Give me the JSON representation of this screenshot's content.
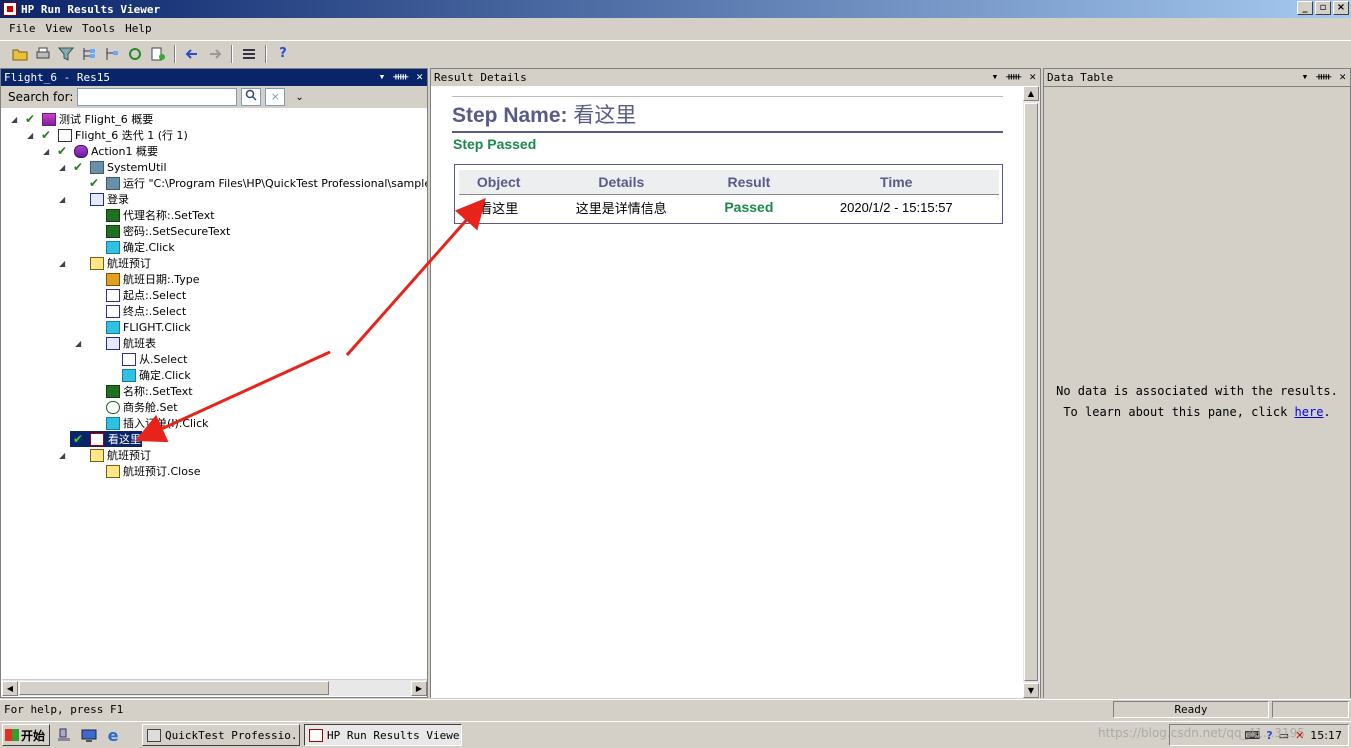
{
  "window": {
    "title": "HP Run Results Viewer"
  },
  "menu": [
    "File",
    "View",
    "Tools",
    "Help"
  ],
  "left_panel": {
    "title": "Flight_6 - Res15",
    "search_label": "Search for:",
    "search_value": "",
    "tree": [
      {
        "label": "测试 Flight_6 概要"
      },
      {
        "label": "Flight_6 迭代 1 (行 1)"
      },
      {
        "label": "Action1 概要"
      },
      {
        "label": "SystemUtil"
      },
      {
        "label": "运行 \"C:\\Program Files\\HP\\QuickTest Professional\\samples\\flig"
      },
      {
        "label": "登录"
      },
      {
        "label": "代理名称:.SetText"
      },
      {
        "label": "密码:.SetSecureText"
      },
      {
        "label": "确定.Click"
      },
      {
        "label": "航班预订"
      },
      {
        "label": "航班日期:.Type"
      },
      {
        "label": "起点:.Select"
      },
      {
        "label": "终点:.Select"
      },
      {
        "label": "FLIGHT.Click"
      },
      {
        "label": "航班表"
      },
      {
        "label": "从.Select"
      },
      {
        "label": "确定.Click"
      },
      {
        "label": "名称:.SetText"
      },
      {
        "label": "商务舱.Set"
      },
      {
        "label": "插入订单(I).Click"
      },
      {
        "label": "看这里"
      },
      {
        "label": "航班预订"
      },
      {
        "label": "航班预订.Close"
      }
    ]
  },
  "result_details": {
    "title": "Result Details",
    "step_name_label": "Step Name:",
    "step_name": "看这里",
    "status": "Step Passed",
    "columns": [
      "Object",
      "Details",
      "Result",
      "Time"
    ],
    "row": {
      "object": "看这里",
      "details": "这里是详情信息",
      "result": "Passed",
      "time": "2020/1/2 - 15:15:57"
    }
  },
  "data_table": {
    "title": "Data Table",
    "line1": "No data is associated with the results.",
    "line2_prefix": "To learn about this pane, click ",
    "link": "here",
    "line2_suffix": "."
  },
  "statusbar": {
    "help": "For help, press F1",
    "ready": "Ready"
  },
  "taskbar": {
    "start": "开始",
    "tasks": [
      "QuickTest Professio...",
      "HP Run Results Viewer"
    ],
    "clock": "15:17",
    "watermark": "https://blog.csdn.net/qq_41...3195"
  },
  "colors": {
    "accent": "#0a246a",
    "passed": "#1a8a4a",
    "header_text": "#5a5a8a",
    "arrow": "#e8231a"
  }
}
